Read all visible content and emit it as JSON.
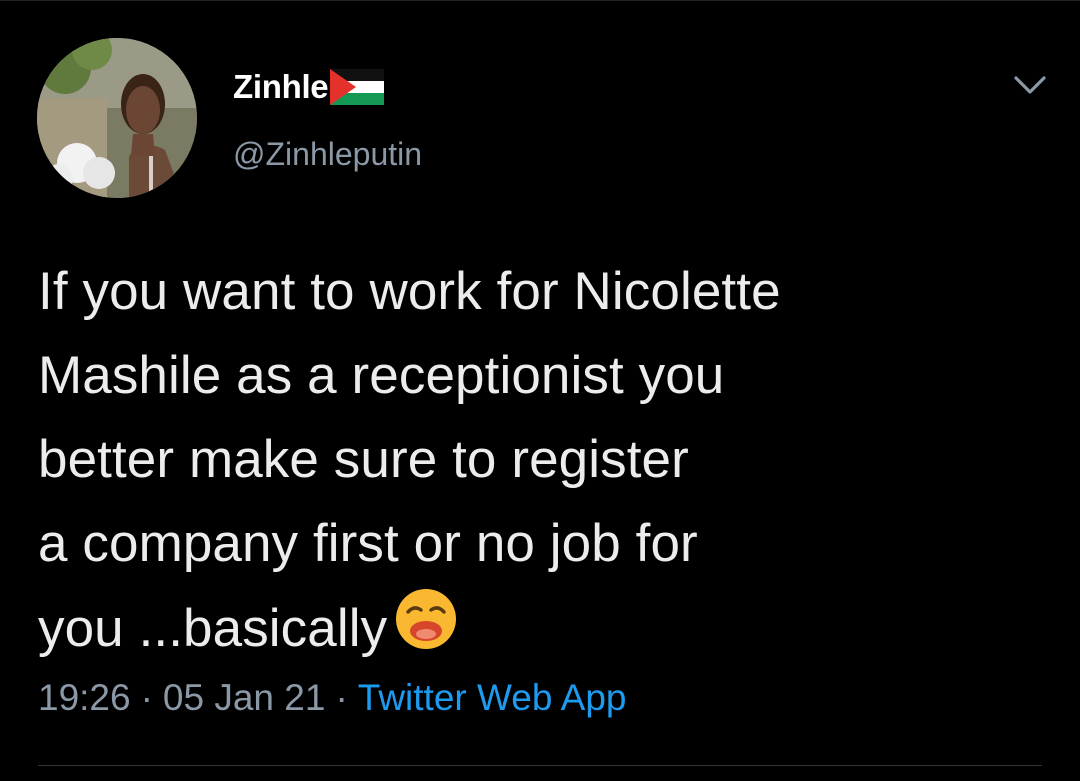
{
  "tweet": {
    "author": {
      "display_name": "Zinhle",
      "handle": "@Zinhleputin",
      "flag": "palestine-flag-icon"
    },
    "text_lines": [
      "If you want to work for Nicolette",
      "Mashile as a receptionist you",
      "better make sure to register",
      "a company first or no job for",
      "you ...basically"
    ],
    "emoji": "anguished-face-icon",
    "meta": {
      "time": "19:26",
      "separator": "·",
      "date": "05 Jan 21",
      "source": "Twitter Web App"
    }
  },
  "colors": {
    "background": "#000000",
    "text_primary": "#ececec",
    "text_secondary": "#8b98a5",
    "link": "#1d9bf0",
    "divider": "#2f3336"
  }
}
